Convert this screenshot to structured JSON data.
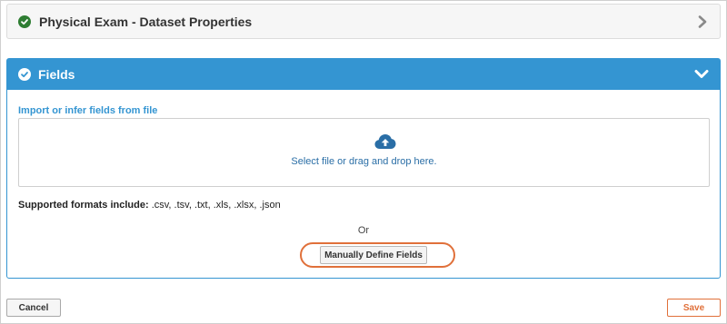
{
  "dataset_panel": {
    "title": "Physical Exam - Dataset Properties",
    "status_icon": "check-circle-icon",
    "toggle_icon": "chevron-right-icon"
  },
  "fields_panel": {
    "title": "Fields",
    "status_icon": "check-circle-icon",
    "toggle_icon": "chevron-down-icon",
    "import_label": "Import or infer fields from file",
    "dropzone": {
      "icon": "cloud-upload-icon",
      "text": "Select file or drag and drop here."
    },
    "formats_label": "Supported formats include:",
    "formats_list": ".csv, .tsv, .txt, .xls, .xlsx, .json",
    "or_text": "Or",
    "manual_button": "Manually Define Fields"
  },
  "footer": {
    "cancel_label": "Cancel",
    "save_label": "Save"
  },
  "colors": {
    "accent_blue": "#3495d2",
    "success_green": "#2e7d32",
    "save_orange": "#e0703a"
  }
}
